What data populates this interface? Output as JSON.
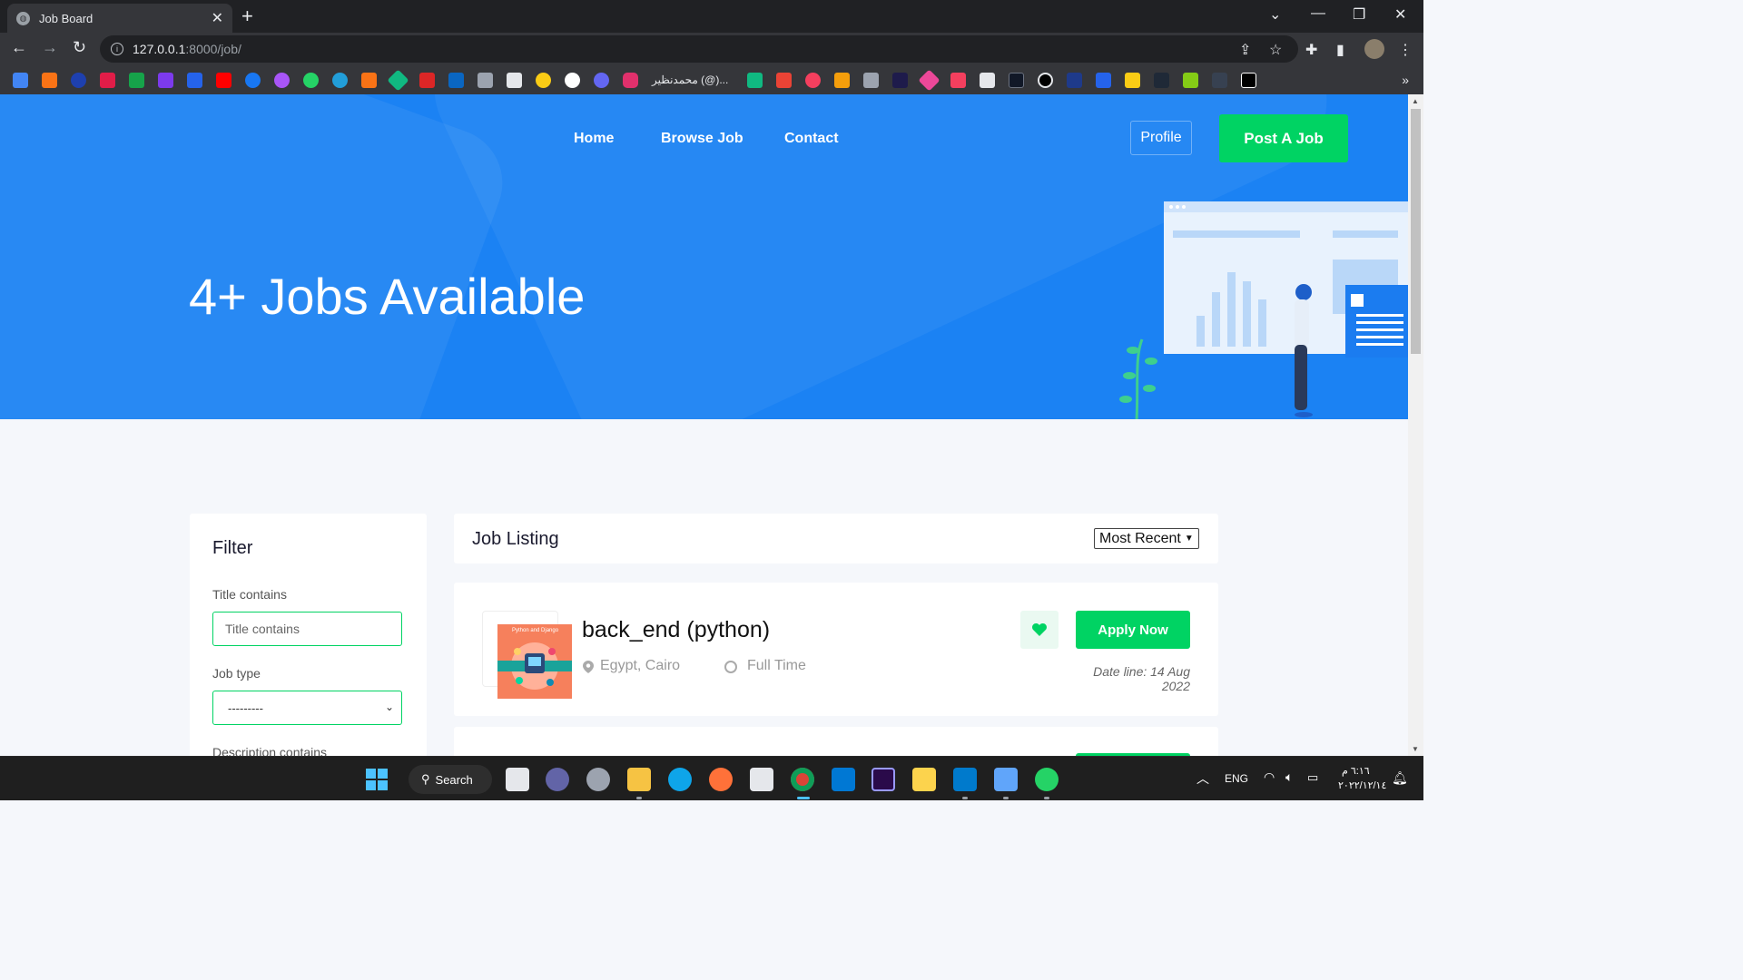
{
  "browser": {
    "tab_title": "Job Board",
    "url_host": "127.0.0.1",
    "url_path": ":8000/job/",
    "bookmark_text": "محمدنظير (@)..."
  },
  "site": {
    "nav": [
      "Home",
      "Browse Job",
      "Contact"
    ],
    "profile_label": "Profile",
    "post_job_label": "Post A Job",
    "hero_title": "4+ Jobs Available",
    "colors": {
      "hero_blue": "#1b82f3",
      "accent_green": "#00d363",
      "page_bg": "#f5f7fb"
    }
  },
  "filter": {
    "title": "Filter",
    "title_label": "Title contains",
    "title_placeholder": "Title contains",
    "job_type_label": "Job type",
    "job_type_value": "---------",
    "description_label": "Description contains"
  },
  "listing": {
    "title": "Job Listing",
    "sort_value": "Most Recent",
    "jobs": [
      {
        "title": "back_end (python)",
        "location": "Egypt, Cairo",
        "type": "Full Time",
        "deadline": "Date line: 14 Aug 2022",
        "apply_label": "Apply Now",
        "logo_caption": "Python and Django"
      }
    ]
  },
  "taskbar": {
    "search_label": "Search",
    "lang": "ENG",
    "time": "٦:١٦ م",
    "date": "٢٠٢٢/١٢/١٤"
  }
}
